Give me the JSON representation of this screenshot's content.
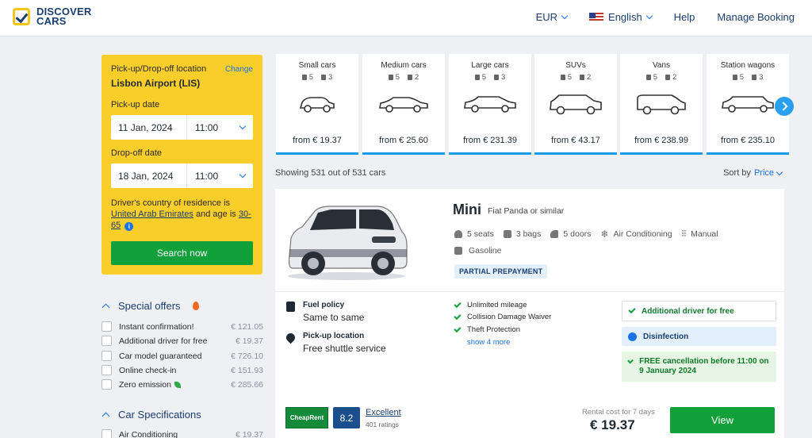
{
  "brand": {
    "line1": "DISCOVER",
    "line2": "CARS"
  },
  "nav": {
    "currency": "EUR",
    "language": "English",
    "help": "Help",
    "manage": "Manage Booking"
  },
  "search": {
    "location_label": "Pick-up/Drop-off location",
    "change": "Change",
    "location": "Lisbon Airport (LIS)",
    "pickup_label": "Pick-up date",
    "pickup_date": "11 Jan, 2024",
    "pickup_time": "11:00",
    "dropoff_label": "Drop-off date",
    "dropoff_date": "18 Jan, 2024",
    "dropoff_time": "11:00",
    "residence_prefix": "Driver's country of residence is",
    "country": "United Arab Emirates",
    "age_text": "and age is",
    "age": "30-65",
    "button": "Search now"
  },
  "filters": {
    "special_title": "Special offers",
    "special": [
      {
        "label": "Instant confirmation!",
        "price": "€ 121.05"
      },
      {
        "label": "Additional driver for free",
        "price": "€ 19.37"
      },
      {
        "label": "Car model guaranteed",
        "price": "€ 726.10"
      },
      {
        "label": "Online check-in",
        "price": "€ 151.93"
      },
      {
        "label": "Zero emission",
        "price": "€ 285.66"
      }
    ],
    "spec_title": "Car Specifications",
    "spec": [
      {
        "label": "Air Conditioning",
        "price": "€ 19.37"
      }
    ]
  },
  "categories": [
    {
      "name": "Small cars",
      "seats": "5",
      "bags": "3",
      "price": "from € 19.37"
    },
    {
      "name": "Medium cars",
      "seats": "5",
      "bags": "2",
      "price": "from € 25.60"
    },
    {
      "name": "Large cars",
      "seats": "5",
      "bags": "3",
      "price": "from € 231.39"
    },
    {
      "name": "SUVs",
      "seats": "5",
      "bags": "2",
      "price": "from € 43.17"
    },
    {
      "name": "Vans",
      "seats": "5",
      "bags": "2",
      "price": "from € 238.99"
    },
    {
      "name": "Station wagons",
      "seats": "5",
      "bags": "3",
      "price": "from € 235.10"
    }
  ],
  "results": {
    "showing": "Showing 531 out of 531 cars",
    "sort_label": "Sort by",
    "sort_value": "Price"
  },
  "car": {
    "name": "Mini",
    "similar": "Fiat Panda or similar",
    "seats": "5 seats",
    "bags": "3 bags",
    "doors": "5 doors",
    "ac": "Air Conditioning",
    "transmission": "Manual",
    "fuel": "Gasoline",
    "badge": "PARTIAL PREPAYMENT",
    "fuel_policy_label": "Fuel policy",
    "fuel_policy": "Same to same",
    "pickup_label": "Pick-up location",
    "pickup": "Free shuttle service",
    "included": [
      "Unlimited mileage",
      "Collision Damage Waiver",
      "Theft Protection"
    ],
    "show_more": "show 4 more",
    "perk_driver": "Additional driver for free",
    "perk_disinfection": "Disinfection",
    "perk_cancel": "FREE cancellation before 11:00 on 9 January 2024",
    "supplier": "CheapRent",
    "score": "8.2",
    "rating_word": "Excellent",
    "rating_count": "401 ratings",
    "cost_label": "Rental cost for 7 days",
    "cost": "€ 19.37",
    "view": "View"
  },
  "colors": {
    "brand_yellow": "#f9cd2a",
    "brand_navy": "#1a3e72",
    "cta_green": "#12a03b",
    "accent_blue": "#1a9de8"
  }
}
